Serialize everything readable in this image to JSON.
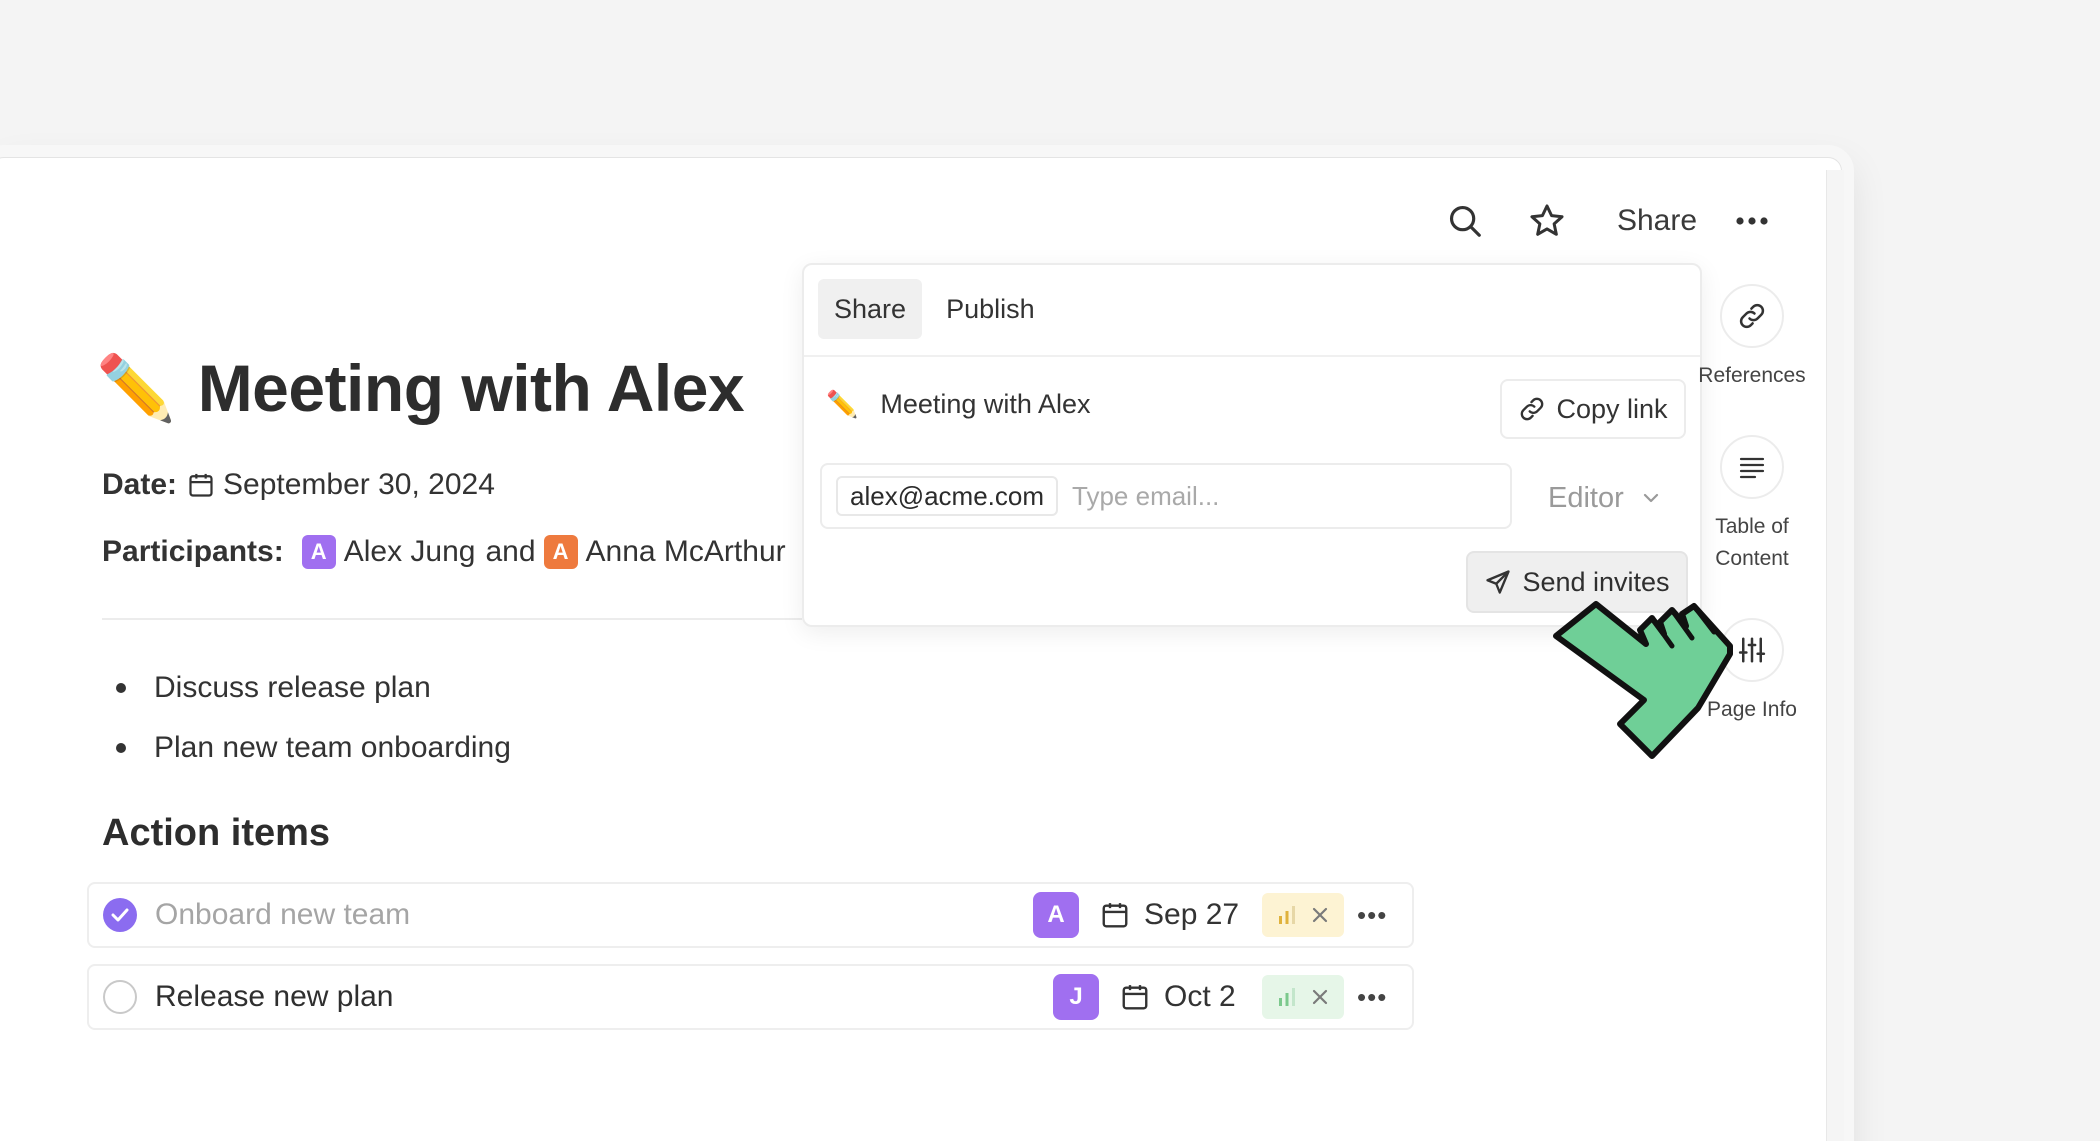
{
  "toolbar": {
    "search_icon": "search-icon",
    "star_icon": "star-icon",
    "share_label": "Share",
    "more_icon": "more-icon"
  },
  "document": {
    "title_emoji": "✏️",
    "title": "Meeting with Alex",
    "date_label": "Date:",
    "date_value": "September 30, 2024",
    "participants_label": "Participants:",
    "participant_1_initial": "A",
    "participant_1_name": "Alex Jung",
    "conjunction": "and",
    "participant_2_initial": "A",
    "participant_2_name": "Anna McArthur",
    "bullets": [
      "Discuss release plan",
      "Plan new team onboarding"
    ],
    "action_heading": "Action items",
    "tasks": [
      {
        "label": "Onboard new team",
        "done": true,
        "assignee": "A",
        "due": "Sep 27",
        "priority_color": "yellow"
      },
      {
        "label": "Release new plan",
        "done": false,
        "assignee": "J",
        "due": "Oct 2",
        "priority_color": "green"
      }
    ]
  },
  "share_popover": {
    "tabs": [
      "Share",
      "Publish"
    ],
    "active_tab": "Share",
    "page_title": "Meeting with Alex",
    "copy_link_label": "Copy link",
    "email_chip": "alex@acme.com",
    "email_placeholder": "Type email...",
    "role": "Editor",
    "send_label": "Send invites"
  },
  "right_rail": {
    "references_label": "References",
    "toc_label_1": "Table of",
    "toc_label_2": "Content",
    "page_info_label": "Page Info"
  },
  "colors": {
    "accent_purple": "#8b6cf0",
    "avatar_purple": "#a06ff0",
    "avatar_orange": "#ee7a3e",
    "cursor_green": "#6fcf97"
  }
}
